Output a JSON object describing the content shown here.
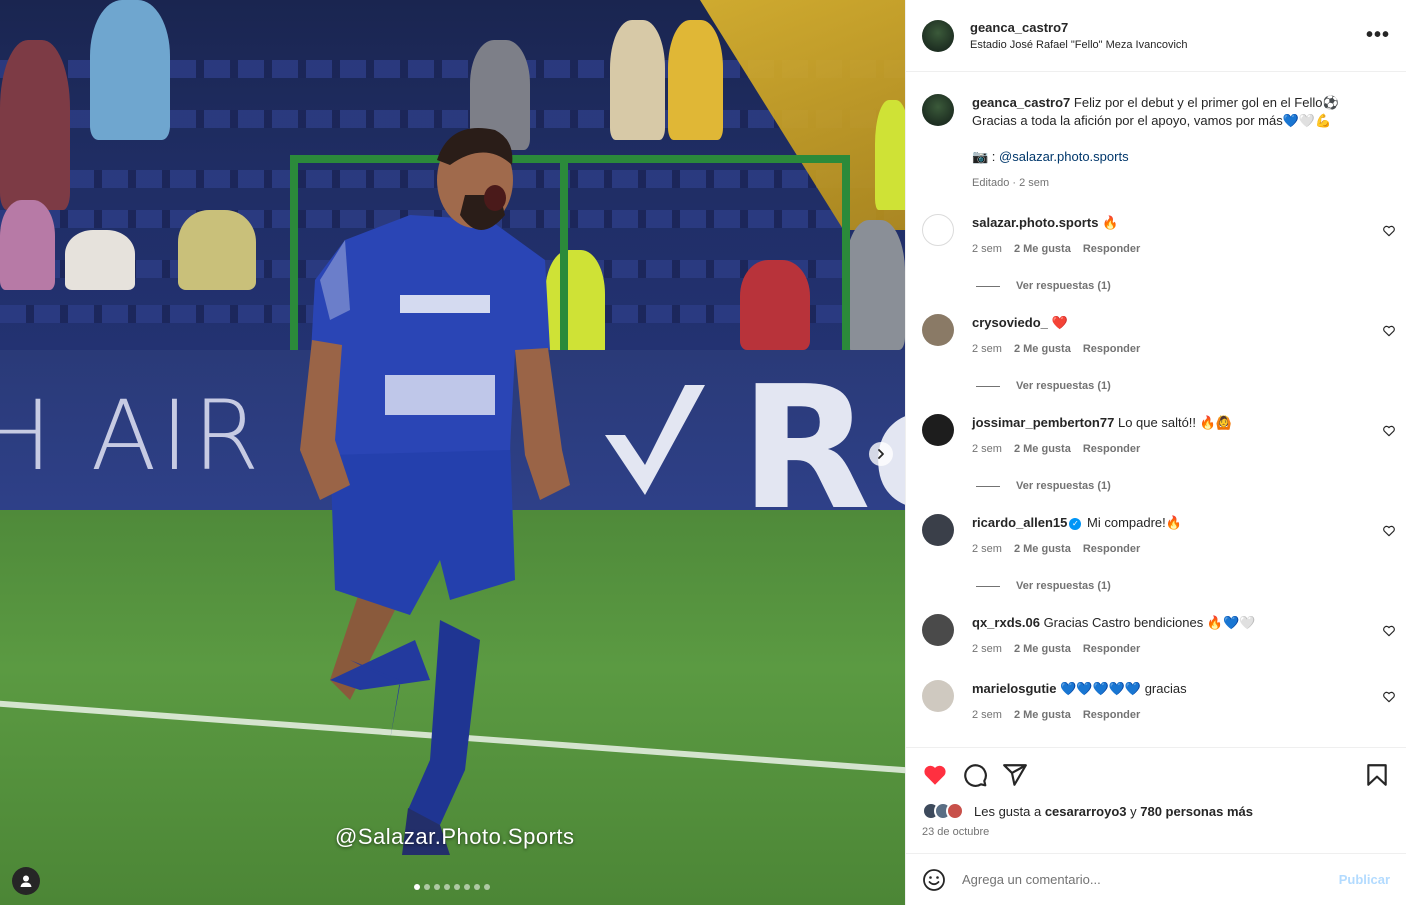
{
  "post": {
    "author": "geanca_castro7",
    "location": "Estadio José Rafael \"Fello\" Meza Ivancovich",
    "caption_line1": "Feliz por el debut y el primer gol en el Fello⚽",
    "caption_line2": "Gracias a toda la afición por el apoyo, vamos por más💙🤍💪",
    "credit_prefix": "📷 : ",
    "credit_mention": "@salazar.photo.sports",
    "caption_meta": "Editado · 2 sem",
    "more_label": "•••"
  },
  "media": {
    "watermark": "@Salazar.Photo.Sports",
    "board_left": "H AIR",
    "board_right": "Re",
    "carousel_count": 8,
    "carousel_active": 0
  },
  "comments": [
    {
      "user": "salazar.photo.sports",
      "text": "🔥",
      "time": "2 sem",
      "likes": "2 Me gusta",
      "reply": "Responder",
      "replies": "Ver respuestas (1)",
      "verified": false,
      "avatar_color": "#ffffff"
    },
    {
      "user": "crysoviedo_",
      "text": "❤️",
      "time": "2 sem",
      "likes": "2 Me gusta",
      "reply": "Responder",
      "replies": "Ver respuestas (1)",
      "verified": false,
      "avatar_color": "#8a7a66"
    },
    {
      "user": "jossimar_pemberton77",
      "text": "Lo que saltó!! 🔥🙆",
      "time": "2 sem",
      "likes": "2 Me gusta",
      "reply": "Responder",
      "replies": "Ver respuestas (1)",
      "verified": false,
      "avatar_color": "#1d1d1d"
    },
    {
      "user": "ricardo_allen15",
      "text": "Mi compadre!🔥",
      "time": "2 sem",
      "likes": "2 Me gusta",
      "reply": "Responder",
      "replies": "Ver respuestas (1)",
      "verified": true,
      "avatar_color": "#3a3f49"
    },
    {
      "user": "qx_rxds.06",
      "text": "Gracias Castro bendiciones 🔥💙🤍",
      "time": "2 sem",
      "likes": "2 Me gusta",
      "reply": "Responder",
      "replies": "",
      "verified": false,
      "avatar_color": "#4a4a4a"
    },
    {
      "user": "marielosgutie",
      "text": "💙💙💙💙💙 gracias",
      "time": "2 sem",
      "likes": "2 Me gusta",
      "reply": "Responder",
      "replies": "",
      "verified": false,
      "avatar_color": "#cfc9c0"
    }
  ],
  "footer": {
    "likes_prefix": "Les gusta a ",
    "likes_user": "cesararroyo3",
    "likes_mid": " y ",
    "likes_count": "780 personas más",
    "date": "23 de octubre",
    "comment_placeholder": "Agrega un comentario...",
    "publish_label": "Publicar",
    "liked": true
  },
  "colors": {
    "like_red": "#ff3040",
    "link_blue": "#00376b",
    "publish_disabled": "#b3dbff",
    "jersey_blue": "#2a45b5"
  },
  "icons": [
    "heart-icon",
    "comment-icon",
    "share-icon",
    "bookmark-icon",
    "emoji-icon",
    "more-icon",
    "next-arrow-icon",
    "user-tag-icon"
  ]
}
